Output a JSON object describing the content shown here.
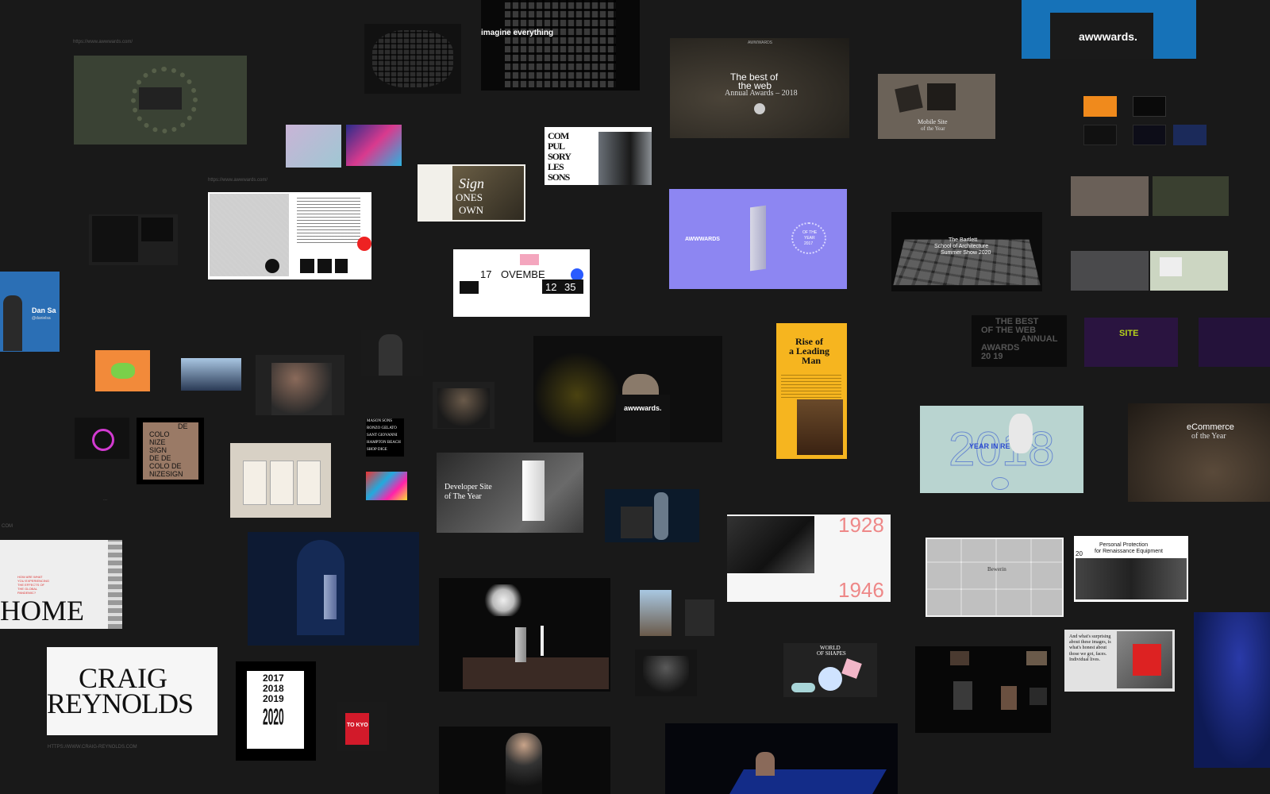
{
  "captions": {
    "top_left": "https://www.awwwards.com/",
    "map": "https://www.awwwards.com/",
    "craig": "HTTPS://WWW.CRAIG-REYNOLDS.COM",
    "small_left": "COM",
    "dot": "..."
  },
  "cards": {
    "imagine": {
      "text": "imagine everything"
    },
    "best_web": {
      "kicker": "AWWWARDS",
      "line1": "The best of",
      "line2": "the web",
      "line3": "Annual Awards – 2018"
    },
    "award_stage_top": {
      "logo": "awwwards."
    },
    "mobile_site": {
      "line1": "Mobile Site",
      "line2": "of the Year"
    },
    "compulsory": {
      "l1": "COM",
      "l2": "PUL",
      "l3": "SORY",
      "l4": "LES",
      "l5": "SONS"
    },
    "sign_own": {
      "l1": "Sign",
      "l2": "ONES",
      "l3": "OWN"
    },
    "awwwards_purple": {
      "brand": "AWWWARDS",
      "badge1": "OF THE",
      "badge2": "YEAR",
      "badge3": "2017"
    },
    "bartlett": {
      "l1": "The Bartlett",
      "l2": "School of Architecture",
      "l3": "Summer Show 2020"
    },
    "calendar": {
      "d1": "17",
      "d2": "OVEMBE",
      "d3": "12",
      "d4": "35"
    },
    "speaker_left": {
      "name": "Dan Sa",
      "handle": "@danielsa"
    },
    "rise": {
      "l1": "Rise of",
      "l2": "a Leading",
      "l3": "Man"
    },
    "best_web_2019": {
      "l1": "THE BEST",
      "l2": "OF THE WEB",
      "l3": "ANNUAL",
      "l4": "AWARDS",
      "l5": "20  19"
    },
    "site_purple": {
      "text": "SITE"
    },
    "stage_awwwards": {
      "logo": "awwwards."
    },
    "decolonize": {
      "l1": "DE",
      "l2": "COLO",
      "l3": "NIZE",
      "l4": "SIGN",
      "l5": "DE DE",
      "l6": "COLO DE",
      "l7": "NIZESIGN"
    },
    "masonry": {
      "l1": "MASON SONS",
      "l2": "RONZO GELATO",
      "l3": "SANT GIOVANNI",
      "l4": "HAMPTON BEACH",
      "l5": "SHOP DIGE"
    },
    "year_review": {
      "big": "2018",
      "label": "YEAR IN REVIEW"
    },
    "ecommerce": {
      "l1": "eCommerce",
      "l2": "of the Year"
    },
    "dev_site": {
      "l1": "Developer Site",
      "l2": "of The Year"
    },
    "portrait_1928": {
      "top": "1928",
      "bottom": "1946"
    },
    "home": {
      "big": "HOME",
      "red": "HOW ARE WHAT YOU EXPERIENCING THE EFFECTS OF THE GLOBAL PANDEMIC?"
    },
    "craig": {
      "l1": "CRAIG",
      "l2": "REYNOLDS"
    },
    "years_poster": {
      "l1": "2017",
      "l2": "2018",
      "l3": "2019",
      "l4": "2020"
    },
    "world_shapes": {
      "l1": "WORLD",
      "l2": "OF SHAPES"
    },
    "bewerin": {
      "label": "Bewerin"
    },
    "personal_protection": {
      "num": "20",
      "l1": "Personal Protection",
      "l2": "for Renaissance Equipment"
    },
    "surprising": {
      "text": "And what's surprising about these images, is what's honest about those we got, faces. Individual lives."
    },
    "tokyo": {
      "text": "TO KYO"
    }
  }
}
